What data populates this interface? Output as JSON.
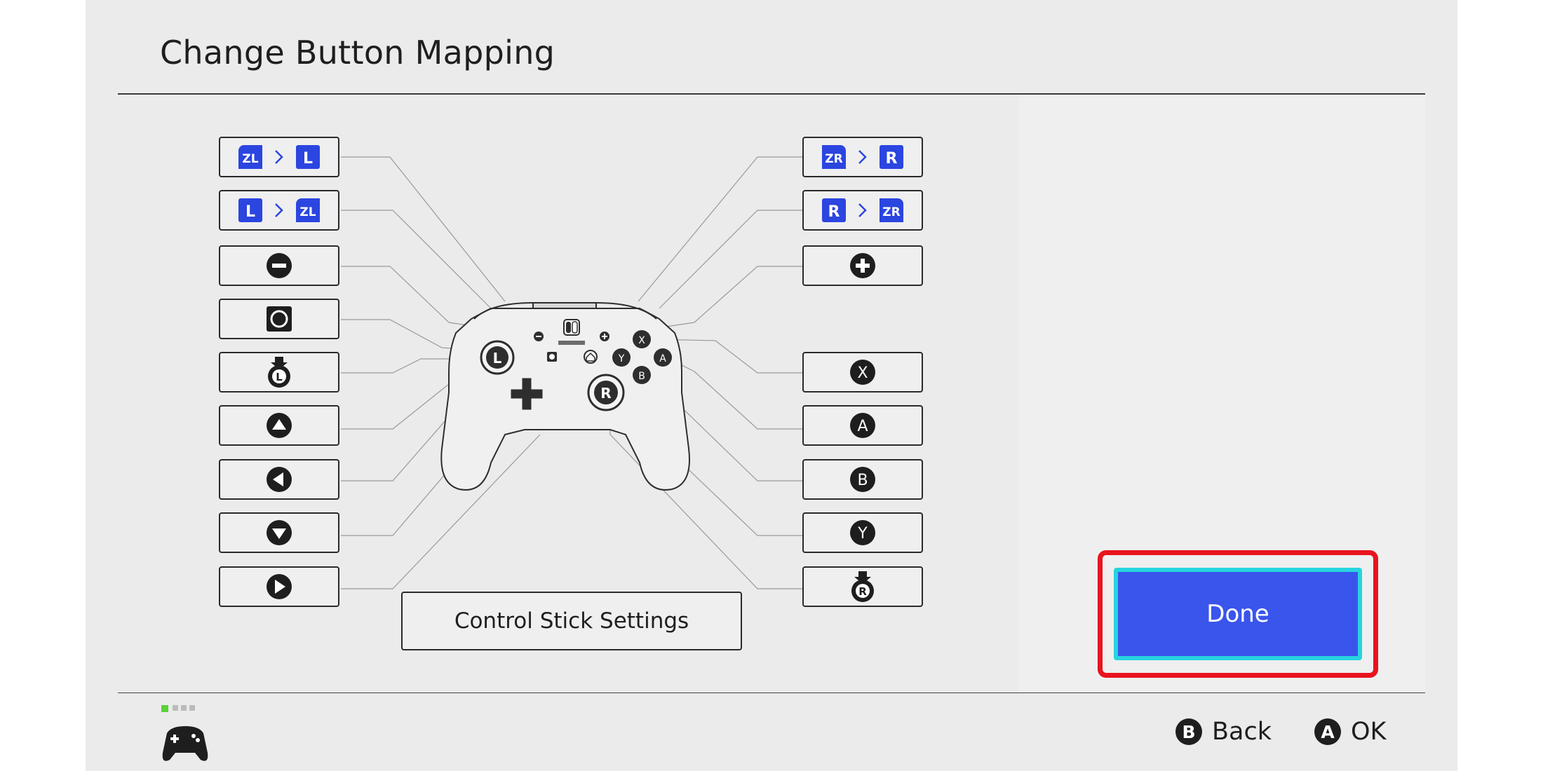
{
  "page": {
    "title": "Change Button Mapping"
  },
  "left_buttons": [
    {
      "name": "zl-to-l-mapping",
      "from": "ZL",
      "to": "L"
    },
    {
      "name": "l-to-zl-mapping",
      "from": "L",
      "to": "ZL"
    },
    {
      "name": "minus-mapping",
      "icon": "minus-icon"
    },
    {
      "name": "capture-mapping",
      "icon": "capture-icon"
    },
    {
      "name": "left-stick-press-mapping",
      "icon": "left-stick-press-icon",
      "label": "L"
    },
    {
      "name": "dpad-up-mapping",
      "icon": "arrow-up-icon"
    },
    {
      "name": "dpad-left-mapping",
      "icon": "arrow-left-icon"
    },
    {
      "name": "dpad-down-mapping",
      "icon": "arrow-down-icon"
    },
    {
      "name": "dpad-right-mapping",
      "icon": "arrow-right-icon"
    }
  ],
  "right_buttons": [
    {
      "name": "zr-to-r-mapping",
      "from": "ZR",
      "to": "R"
    },
    {
      "name": "r-to-zr-mapping",
      "from": "R",
      "to": "ZR"
    },
    {
      "name": "plus-mapping",
      "icon": "plus-icon"
    },
    {
      "name": "x-mapping",
      "label": "X"
    },
    {
      "name": "a-mapping",
      "label": "A"
    },
    {
      "name": "b-mapping",
      "label": "B"
    },
    {
      "name": "y-mapping",
      "label": "Y"
    },
    {
      "name": "right-stick-press-mapping",
      "icon": "right-stick-press-icon",
      "label": "R"
    }
  ],
  "controller": {
    "left_stick": "L",
    "right_stick": "R",
    "face_buttons": [
      "X",
      "A",
      "Y",
      "B"
    ]
  },
  "control_stick_settings": {
    "label": "Control Stick Settings"
  },
  "done_button": {
    "label": "Done"
  },
  "footer": {
    "back": {
      "key": "B",
      "label": "Back"
    },
    "ok": {
      "key": "A",
      "label": "OK"
    }
  },
  "colors": {
    "background": "#ebebeb",
    "key_badge": "#2b45e0",
    "done": "#3a55ec",
    "done_focus": "#27d4de",
    "highlight": "#e8141e",
    "player_indicator": "#5ad13a"
  }
}
